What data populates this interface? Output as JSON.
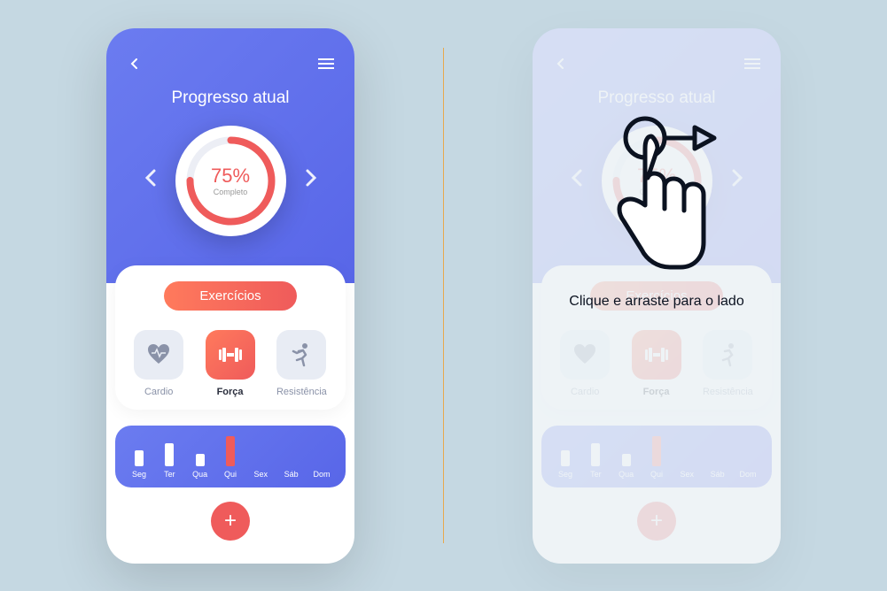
{
  "header": {
    "title": "Progresso atual"
  },
  "progress": {
    "percent": "75%",
    "label": "Completo",
    "value": 75
  },
  "pill_label": "Exercícios",
  "categories": [
    {
      "name": "Cardio",
      "active": false
    },
    {
      "name": "Força",
      "active": true
    },
    {
      "name": "Resistência",
      "active": false
    }
  ],
  "chart_data": {
    "type": "bar",
    "categories": [
      "Seg",
      "Ter",
      "Qua",
      "Qui",
      "Sex",
      "Sáb",
      "Dom"
    ],
    "values": [
      18,
      26,
      14,
      34,
      0,
      0,
      0
    ],
    "highlight_index": 3,
    "title": "",
    "xlabel": "",
    "ylabel": "",
    "ylim": [
      0,
      40
    ]
  },
  "overlay": {
    "instruction": "Clique e arraste para o lado"
  },
  "icons": {
    "back": "back-chevron-icon",
    "menu": "hamburger-icon",
    "prev": "chevron-left-icon",
    "next": "chevron-right-icon",
    "cardio": "heartbeat-icon",
    "strength": "dumbbell-icon",
    "resistance": "runner-icon",
    "add": "plus-icon",
    "swipe": "swipe-hand-icon"
  },
  "colors": {
    "primary": "#5d6de6",
    "accent": "#ef5b5b",
    "bg": "#c5d8e2"
  }
}
